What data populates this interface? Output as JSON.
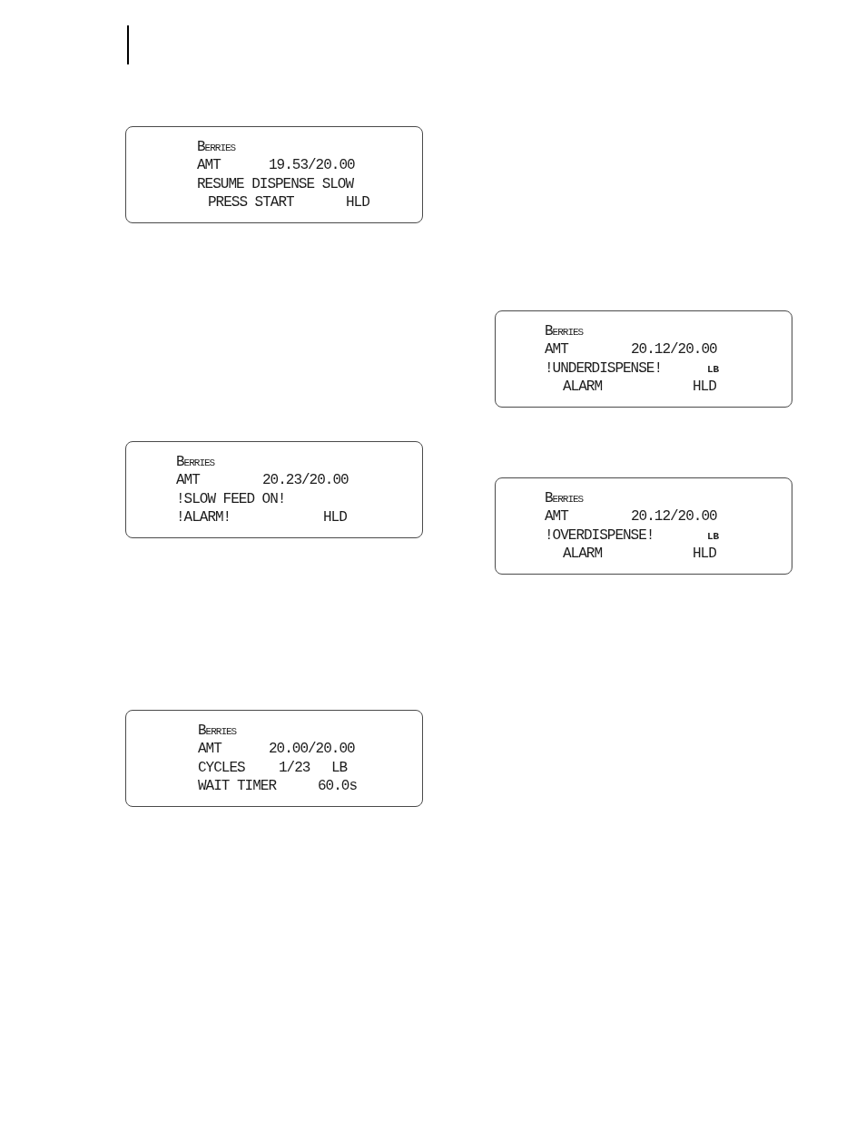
{
  "columns": [
    {
      "displays": [
        {
          "lines": [
            [
              {
                "text": "Berries",
                "kind": "name"
              }
            ],
            [
              {
                "text": "AMT",
                "kind": "field"
              },
              {
                "text": "19.53/20.00",
                "kind": "field"
              }
            ],
            [
              {
                "text": "RESUME DISPENSE SLOW",
                "kind": "field"
              }
            ],
            [
              {
                "text": "PRESS START",
                "kind": "field"
              },
              {
                "text": "HLD",
                "kind": "field"
              }
            ]
          ]
        },
        {
          "lines": [
            [
              {
                "text": "Berries",
                "kind": "name"
              }
            ],
            [
              {
                "text": "AMT",
                "kind": "field"
              },
              {
                "text": "20.23/20.00",
                "kind": "field"
              }
            ],
            [
              {
                "text": "!SLOW FEED ON!",
                "kind": "field"
              }
            ],
            [
              {
                "text": "!ALARM!",
                "kind": "field"
              },
              {
                "text": "HLD",
                "kind": "field"
              }
            ]
          ]
        },
        {
          "lines": [
            [
              {
                "text": "Berries",
                "kind": "name"
              }
            ],
            [
              {
                "text": "AMT",
                "kind": "field"
              },
              {
                "text": "20.00/20.00",
                "kind": "field"
              }
            ],
            [
              {
                "text": "CYCLES",
                "kind": "field"
              },
              {
                "text": "1/23",
                "kind": "field"
              },
              {
                "text": "LB",
                "kind": "field"
              }
            ],
            [
              {
                "text": "WAIT TIMER",
                "kind": "field"
              },
              {
                "text": "60.0s",
                "kind": "field"
              }
            ]
          ]
        }
      ]
    },
    {
      "displays": [
        {
          "lines": [
            [
              {
                "text": "Berries",
                "kind": "name"
              }
            ],
            [
              {
                "text": "AMT",
                "kind": "field"
              },
              {
                "text": "20.12/20.00",
                "kind": "field"
              }
            ],
            [
              {
                "text": "!UNDERDISPENSE!",
                "kind": "field"
              },
              {
                "text": "LB",
                "kind": "indicator"
              }
            ],
            [
              {
                "text": "ALARM",
                "kind": "field"
              },
              {
                "text": "HLD",
                "kind": "field"
              }
            ]
          ]
        },
        {
          "lines": [
            [
              {
                "text": "Berries",
                "kind": "name"
              }
            ],
            [
              {
                "text": "AMT",
                "kind": "field"
              },
              {
                "text": "20.12/20.00",
                "kind": "field"
              }
            ],
            [
              {
                "text": "!OVERDISPENSE!",
                "kind": "field"
              },
              {
                "text": "LB",
                "kind": "indicator"
              }
            ],
            [
              {
                "text": "ALARM",
                "kind": "field"
              },
              {
                "text": "HLD",
                "kind": "field"
              }
            ]
          ]
        }
      ]
    }
  ]
}
